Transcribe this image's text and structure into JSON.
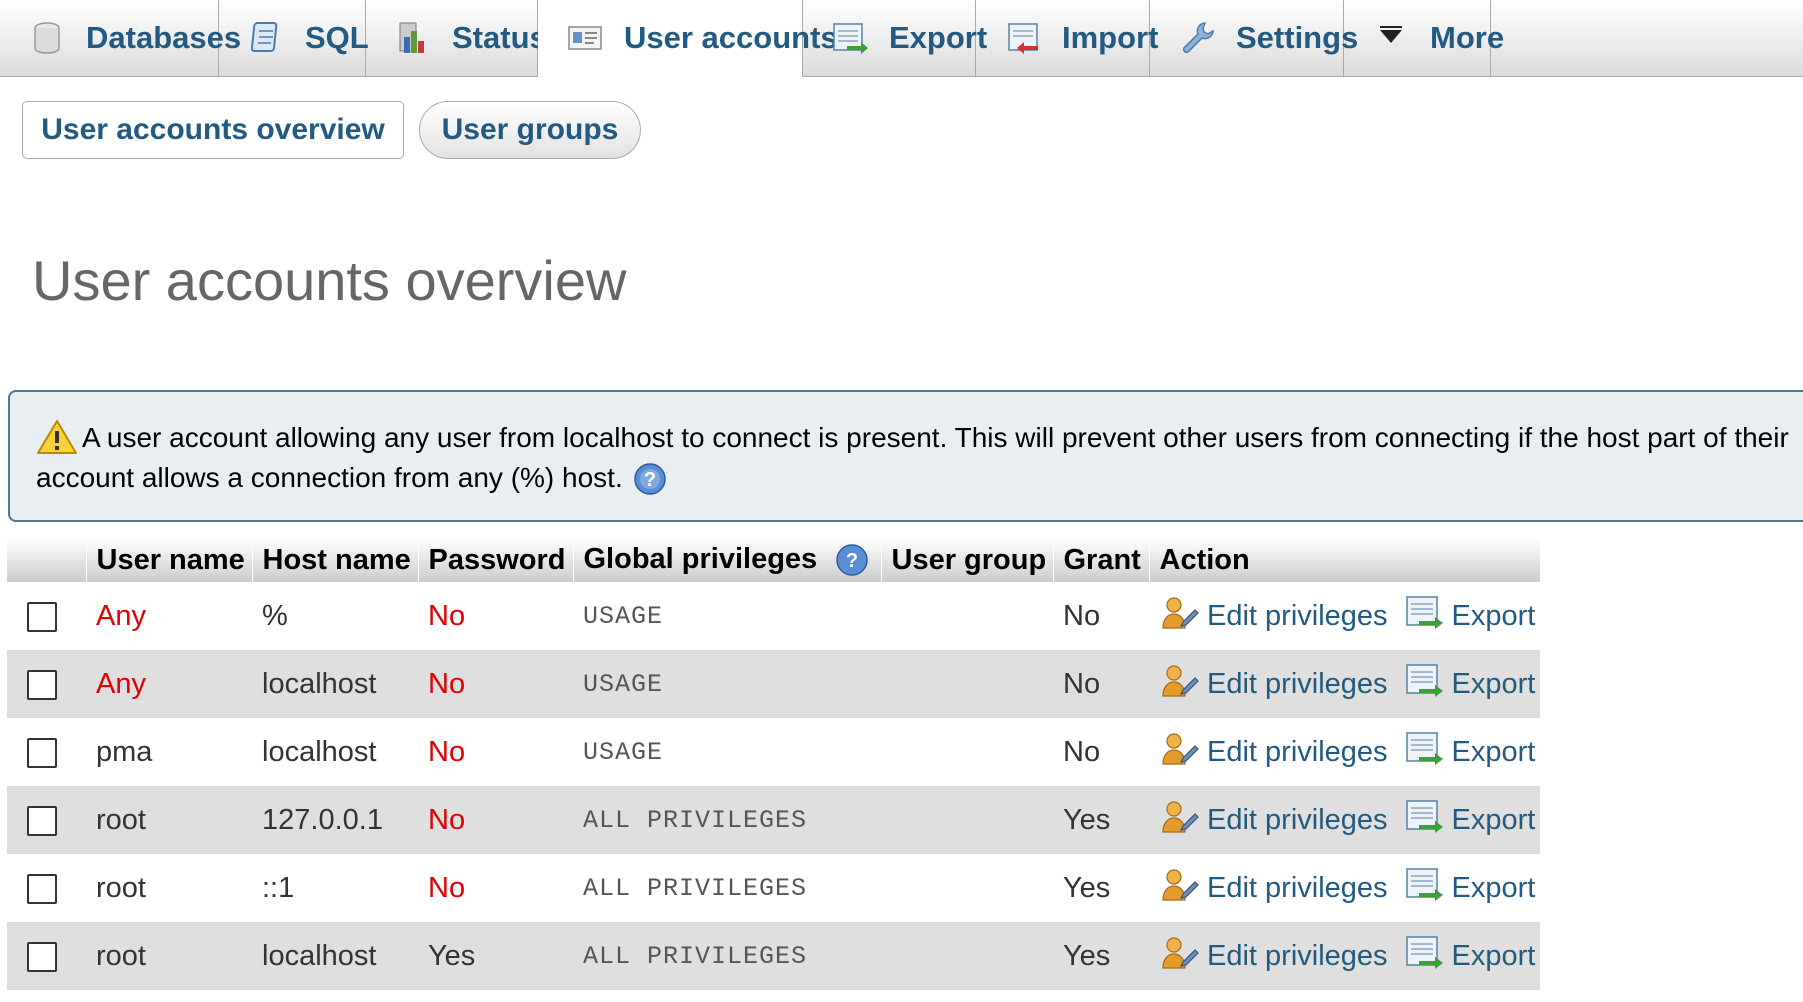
{
  "nav": {
    "tabs": [
      {
        "label": "Databases",
        "icon": "database-icon"
      },
      {
        "label": "SQL",
        "icon": "sql-icon"
      },
      {
        "label": "Status",
        "icon": "status-icon"
      },
      {
        "label": "User accounts",
        "icon": "user-accounts-icon",
        "active": true
      },
      {
        "label": "Export",
        "icon": "export-icon"
      },
      {
        "label": "Import",
        "icon": "import-icon"
      },
      {
        "label": "Settings",
        "icon": "settings-icon"
      },
      {
        "label": "More",
        "icon": "chevron-down-icon"
      }
    ]
  },
  "subtabs": {
    "overview": "User accounts overview",
    "groups": "User groups"
  },
  "page_title": "User accounts overview",
  "notice": {
    "text": "A user account allowing any user from localhost to connect is present. This will prevent other users from connecting if the host part of their account allows a connection from any (%) host."
  },
  "table": {
    "headers": {
      "user": "User name",
      "host": "Host name",
      "password": "Password",
      "global": "Global privileges",
      "group": "User group",
      "grant": "Grant",
      "action": "Action"
    },
    "actions": {
      "edit": "Edit privileges",
      "export": "Export"
    },
    "rows": [
      {
        "user": "Any",
        "host": "%",
        "password": "No",
        "privileges": "USAGE",
        "group": "",
        "grant": "No"
      },
      {
        "user": "Any",
        "host": "localhost",
        "password": "No",
        "privileges": "USAGE",
        "group": "",
        "grant": "No"
      },
      {
        "user": "pma",
        "host": "localhost",
        "password": "No",
        "privileges": "USAGE",
        "group": "",
        "grant": "No"
      },
      {
        "user": "root",
        "host": "127.0.0.1",
        "password": "No",
        "privileges": "ALL PRIVILEGES",
        "group": "",
        "grant": "Yes"
      },
      {
        "user": "root",
        "host": "::1",
        "password": "No",
        "privileges": "ALL PRIVILEGES",
        "group": "",
        "grant": "Yes"
      },
      {
        "user": "root",
        "host": "localhost",
        "password": "Yes",
        "privileges": "ALL PRIVILEGES",
        "group": "",
        "grant": "Yes"
      }
    ]
  },
  "colors": {
    "link": "#235a81",
    "warning_red": "#e00000",
    "notice_border": "#4d7a8f",
    "notice_bg": "#e8eef1",
    "row_stripe": "#dfdfdf"
  }
}
